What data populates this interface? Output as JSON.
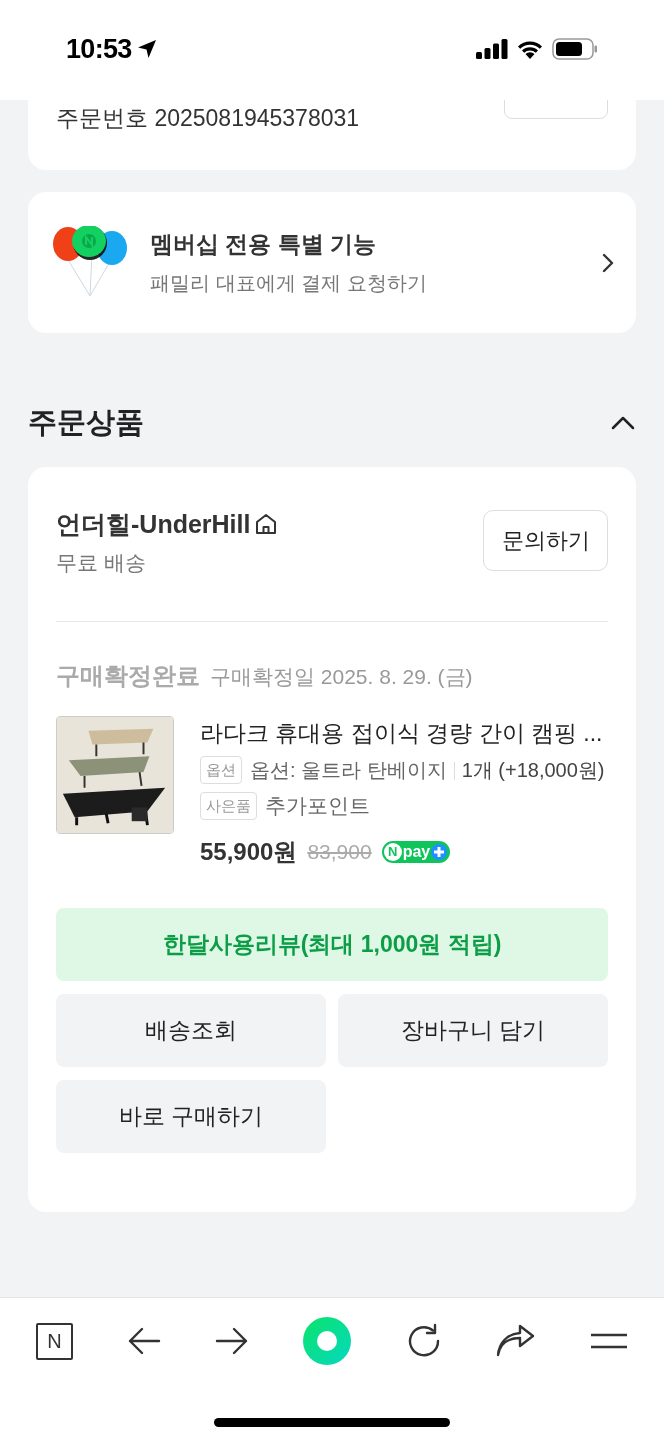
{
  "status_bar": {
    "time": "10:53"
  },
  "order": {
    "order_number": "주문번호 2025081945378031"
  },
  "membership_banner": {
    "title": "멤버십 전용 특별 기능",
    "subtitle": "패밀리 대표에게 결제 요청하기"
  },
  "order_items": {
    "title": "주문상품",
    "expanded": true,
    "seller": {
      "name": "언더힐-UnderHill",
      "shipping": "무료 배송",
      "inquiry_button": "문의하기"
    },
    "status": "구매확정완료",
    "confirmed_date": "구매확정일 2025. 8. 29. (금)",
    "product": {
      "name": "라다크 휴대용 접이식 경량 간이 캠핑 ...",
      "options": [
        {
          "tag": "옵션",
          "text": "옵션: 울트라 탄베이지",
          "quantity": "1개 (+18,000원)"
        },
        {
          "tag": "사은품",
          "text": "추가포인트"
        }
      ],
      "price": "55,900원",
      "original_price": "83,900",
      "badge": {
        "mark": "N",
        "text": "pay"
      }
    },
    "review_button": "한달사용리뷰(최대 1,000원 적립)",
    "actions": [
      "배송조회",
      "장바구니 담기",
      "바로 구매하기"
    ]
  },
  "bottom_nav": {
    "logo": "N"
  }
}
